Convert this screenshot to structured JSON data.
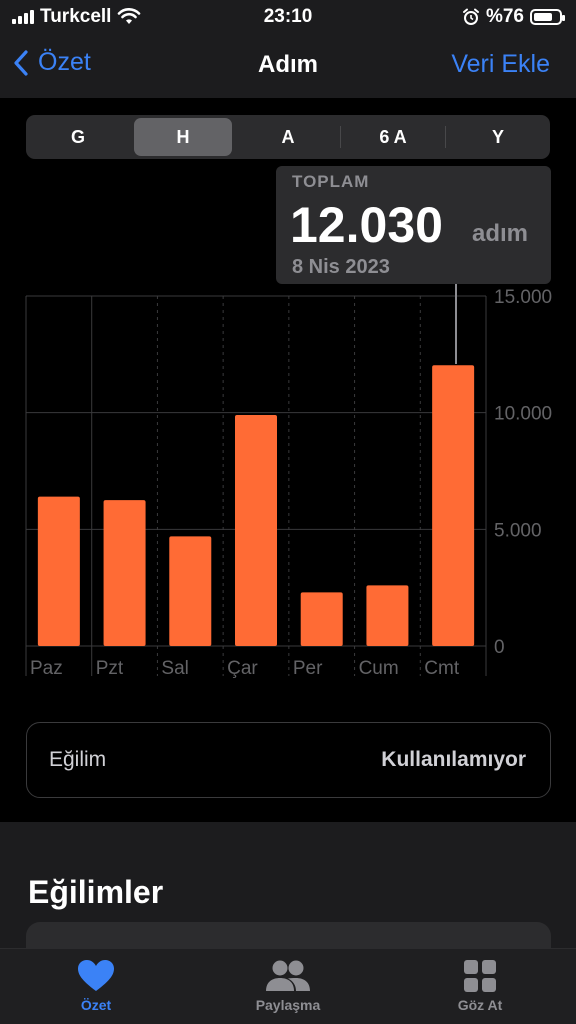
{
  "status_bar": {
    "carrier": "Turkcell",
    "time": "23:10",
    "battery_text": "%76",
    "battery_level": 0.76,
    "icons": [
      "signal-icon",
      "wifi-icon",
      "alarm-icon",
      "battery-icon"
    ]
  },
  "nav": {
    "back_label": "Özet",
    "title": "Adım",
    "add_label": "Veri Ekle"
  },
  "segmented": {
    "options": [
      "G",
      "H",
      "A",
      "6 A",
      "Y"
    ],
    "selected": "H"
  },
  "tooltip": {
    "label": "TOPLAM",
    "value": "12.030",
    "unit": "adım",
    "date": "8 Nis 2023"
  },
  "chart_data": {
    "type": "bar",
    "categories": [
      "Paz",
      "Pzt",
      "Sal",
      "Çar",
      "Per",
      "Cum",
      "Cmt"
    ],
    "values": [
      6400,
      6250,
      4700,
      9900,
      2300,
      2600,
      12030
    ],
    "y_ticks": [
      "15.000",
      "10.000",
      "5.000",
      "0"
    ],
    "ylim": [
      0,
      15000
    ],
    "highlighted_index": 6,
    "bar_color": "#ff6b35",
    "grid": true
  },
  "trend": {
    "label": "Eğilim",
    "value": "Kullanılamıyor"
  },
  "section": {
    "title": "Eğilimler"
  },
  "tabbar": {
    "tabs": [
      {
        "label": "Özet",
        "icon": "heart-icon",
        "active": true
      },
      {
        "label": "Paylaşma",
        "icon": "people-icon",
        "active": false
      },
      {
        "label": "Göz At",
        "icon": "grid-icon",
        "active": false
      }
    ],
    "accent": "#3b82f6"
  }
}
